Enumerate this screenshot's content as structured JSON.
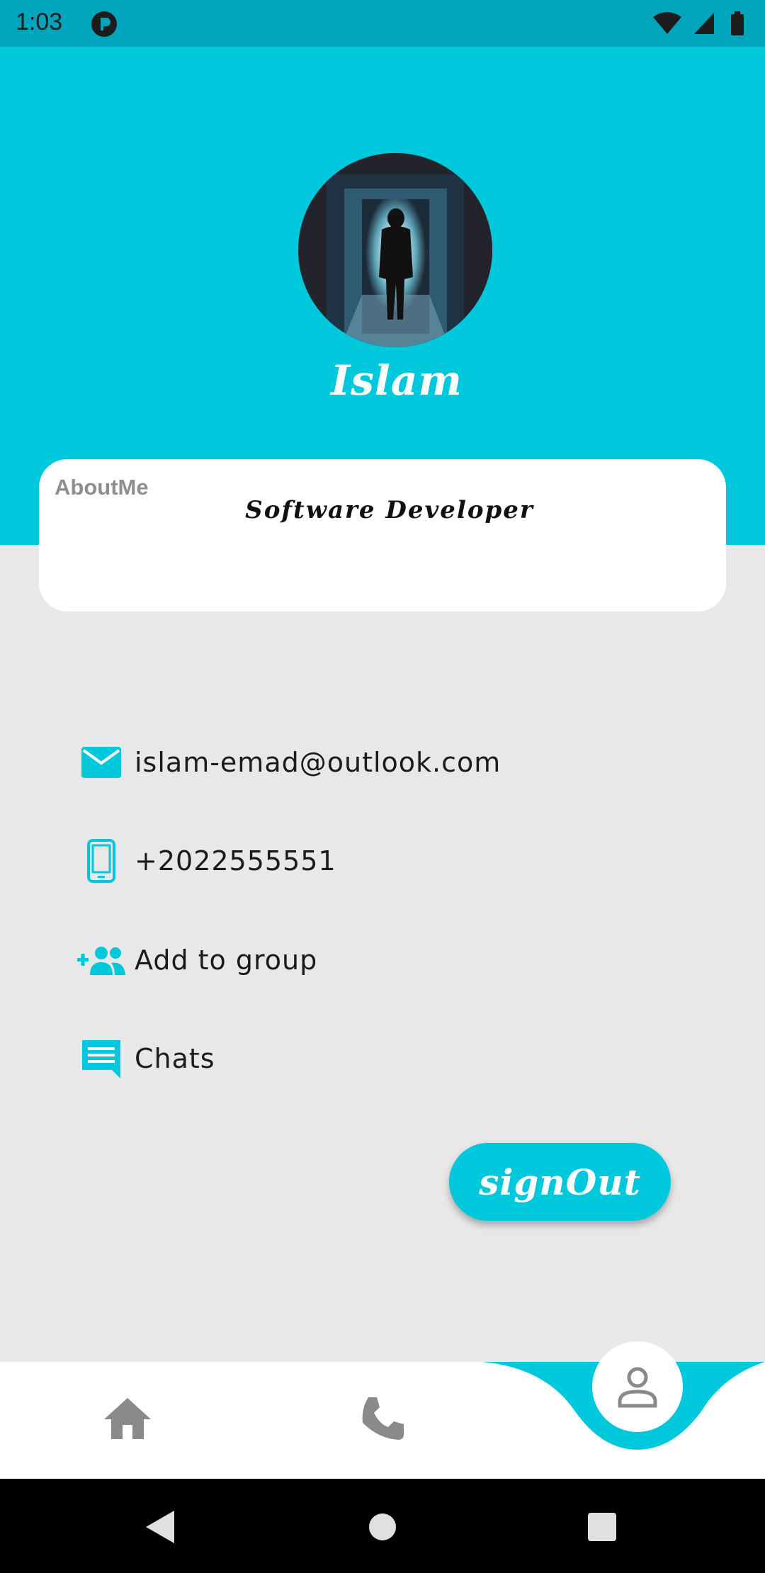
{
  "status_bar": {
    "time": "1:03"
  },
  "profile": {
    "name": "Islam",
    "about_label": "AboutMe",
    "about_value": "Software Developer"
  },
  "info": {
    "email": "islam-emad@outlook.com",
    "phone": "+2022555551",
    "add_group": "Add to group",
    "chats": "Chats"
  },
  "actions": {
    "signout_label": "signOut"
  },
  "colors": {
    "accent": "#00c8dc",
    "status_bar": "#00a5bd",
    "background": "#e8e8e8",
    "nav_icon_inactive": "#8a8a8a"
  },
  "bottom_nav": {
    "items": [
      {
        "icon": "home-icon",
        "active": false
      },
      {
        "icon": "phone-icon",
        "active": false
      },
      {
        "icon": "person-icon",
        "active": true
      }
    ]
  }
}
